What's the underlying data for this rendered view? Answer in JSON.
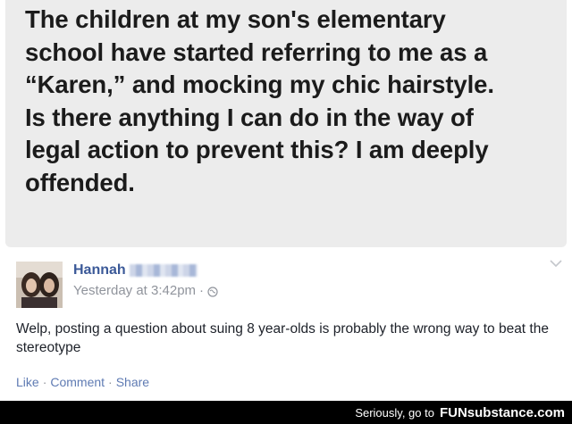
{
  "post": {
    "lines": [
      "The children at my son's elementary",
      "school have started referring to me as a",
      "“Karen,” and mocking my chic hairstyle.",
      "Is there anything I can do in the way of",
      "legal action to prevent this? I am deeply",
      "offended."
    ]
  },
  "comment": {
    "author": "Hannah",
    "timestamp": "Yesterday at 3:42pm",
    "separator": "·",
    "text": "Welp, posting a question about suing 8 year-olds is probably the wrong way to beat the stereotype",
    "actions": [
      "Like",
      "Comment",
      "Share"
    ],
    "icons": {
      "privacy": "globe-icon",
      "options": "chevron-down-icon"
    }
  },
  "watermark": {
    "prefix": "Seriously, go to",
    "brand": "FUNsubstance.com"
  },
  "colors": {
    "link_blue": "#3b5998",
    "meta_gray": "#90949c",
    "post_bg": "#ececec"
  }
}
